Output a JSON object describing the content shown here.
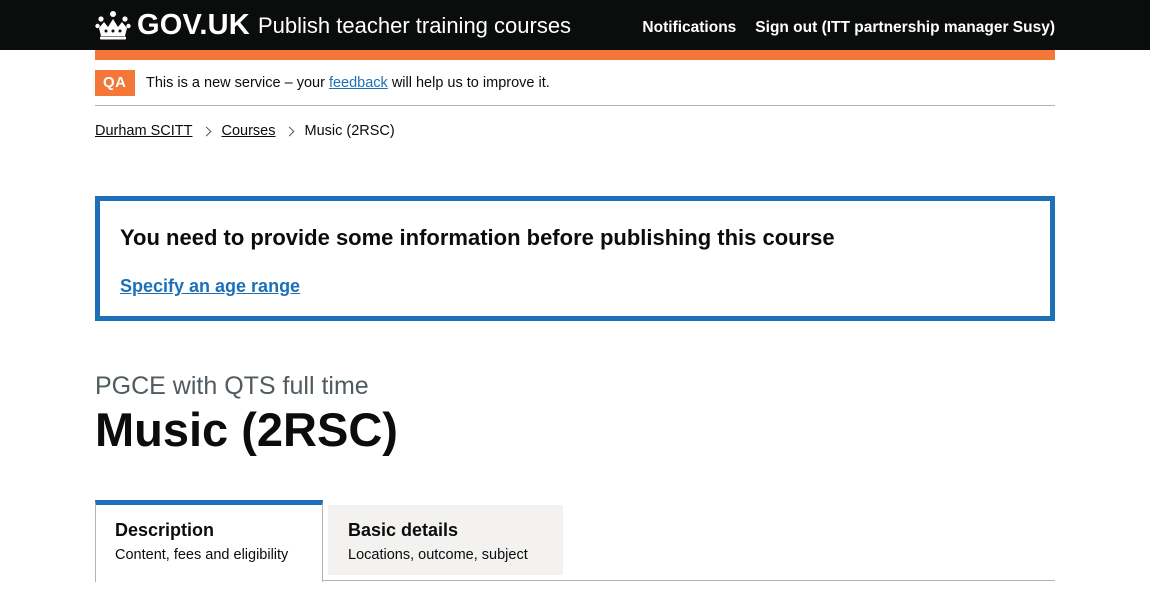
{
  "header": {
    "logo_text": "GOV.UK",
    "service_name": "Publish teacher training courses",
    "nav": {
      "notifications": "Notifications",
      "sign_out": "Sign out (ITT partnership manager Susy)"
    },
    "icons": {
      "logo": "crown-icon"
    }
  },
  "phase_banner": {
    "tag": "QA",
    "text_before": "This is a new service – your ",
    "link": "feedback",
    "text_after": " will help us to improve it."
  },
  "breadcrumbs": {
    "items": [
      "Durham SCITT",
      "Courses"
    ],
    "current": "Music (2RSC)"
  },
  "error_summary": {
    "title": "You need to provide some information before publishing this course",
    "link": "Specify an age range"
  },
  "page": {
    "caption": "PGCE with QTS full time",
    "title": "Music (2RSC)"
  },
  "tabs": [
    {
      "label": "Description",
      "sub": "Content, fees and eligibility",
      "selected": true
    },
    {
      "label": "Basic details",
      "sub": "Locations, outcome, subject",
      "selected": false
    }
  ],
  "colors": {
    "header_bg": "#0b0c0c",
    "accent_orange": "#f47738",
    "link_blue": "#1d70b8",
    "tab_inactive_bg": "#f3f2f1"
  }
}
